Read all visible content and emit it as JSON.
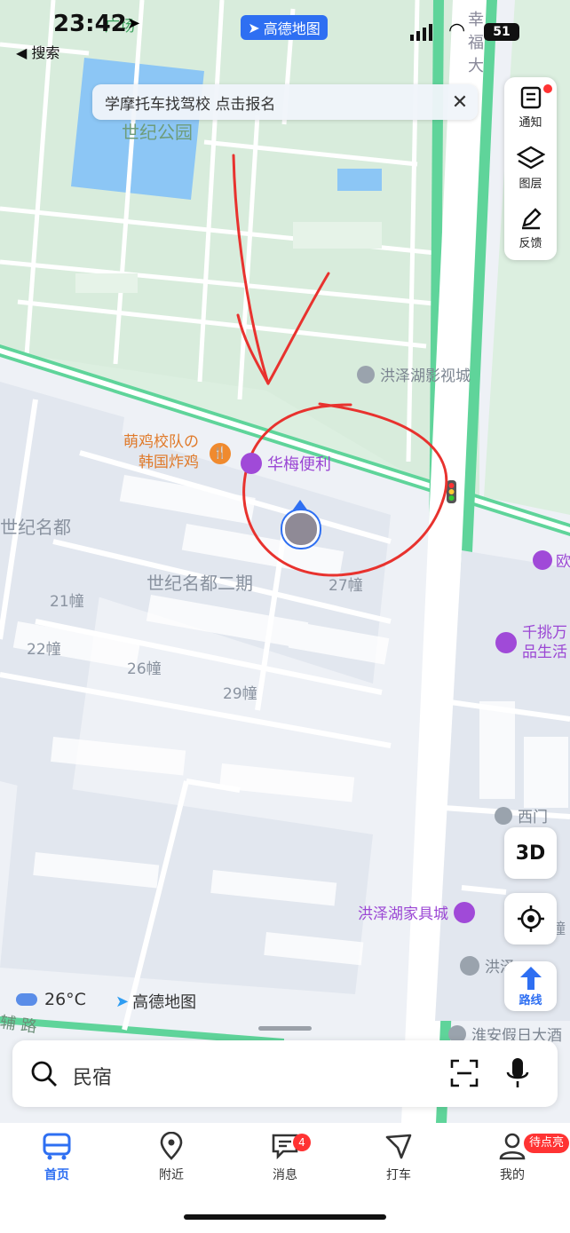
{
  "status_bar": {
    "time": "23:42",
    "back_label": "◀ 搜索",
    "app_badge": "高德地图",
    "battery": "51"
  },
  "banner": {
    "text": "学摩托车找驾校 点击报名"
  },
  "side_panel": {
    "items": [
      {
        "label": "通知",
        "icon": "notice-icon"
      },
      {
        "label": "图层",
        "icon": "layers-icon"
      },
      {
        "label": "反馈",
        "icon": "feedback-pen-icon"
      }
    ]
  },
  "map": {
    "labels": {
      "top_square": "广场",
      "park": "世纪公园",
      "street_top": "幸福大",
      "cinema": "洪泽湖影视城",
      "restaurant_line1": "萌鸡校队の",
      "restaurant_line2": "韩国炸鸡",
      "store": "华梅便利",
      "community_left": "世纪名都",
      "community": "世纪名都二期",
      "bldg21": "21幢",
      "bldg22": "22幢",
      "bldg26": "26幢",
      "bldg27": "27幢",
      "bldg29": "29幢",
      "poi_right_top": "欧",
      "shop_line1": "千挑万",
      "shop_line2": "品生活",
      "west_gate": "西门",
      "furniture": "洪泽湖家具城",
      "road_bottom": "辅 路",
      "hotel": "淮安假日大酒",
      "poi_hong": "洪泽",
      "dong": "幢"
    }
  },
  "buttons": {
    "three_d": "3D",
    "route": "路线"
  },
  "weather": {
    "temp": "26°C"
  },
  "logo": {
    "text": "高德地图"
  },
  "search": {
    "value": "民宿"
  },
  "tabs": [
    {
      "label": "首页",
      "active": true
    },
    {
      "label": "附近"
    },
    {
      "label": "消息",
      "badge": "4"
    },
    {
      "label": "打车"
    },
    {
      "label": "我的",
      "badge": "待点亮"
    }
  ],
  "colors": {
    "accent": "#2e6ff2",
    "road": "#5fd49a",
    "annotation": "#e8322e",
    "park": "#dcefe0",
    "water": "#8cc6f5"
  }
}
